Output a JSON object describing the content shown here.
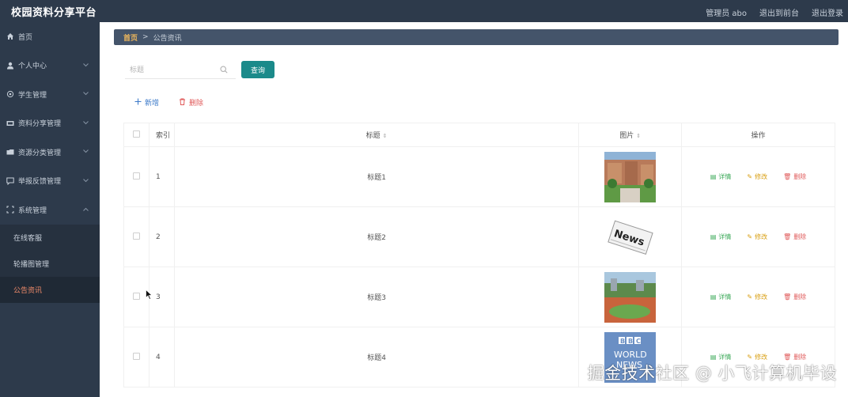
{
  "app": {
    "title": "校园资料分享平台"
  },
  "topbar": {
    "user": "管理员 abo",
    "to_front": "退出到前台",
    "logout": "退出登录"
  },
  "sidebar": {
    "items": [
      {
        "label": "首页",
        "icon": "home-icon"
      },
      {
        "label": "个人中心",
        "icon": "user-icon"
      },
      {
        "label": "学生管理",
        "icon": "gear-icon"
      },
      {
        "label": "资料分享管理",
        "icon": "share-icon"
      },
      {
        "label": "资源分类管理",
        "icon": "folder-icon"
      },
      {
        "label": "举报反馈管理",
        "icon": "chat-icon"
      },
      {
        "label": "系统管理",
        "icon": "system-icon"
      }
    ],
    "sub_items": [
      {
        "label": "在线客服"
      },
      {
        "label": "轮播图管理"
      },
      {
        "label": "公告资讯"
      }
    ]
  },
  "breadcrumb": {
    "home": "首页",
    "separator": ">",
    "current": "公告资讯"
  },
  "search": {
    "placeholder": "标题",
    "value": "",
    "button": "查询"
  },
  "actions": {
    "add": "新增",
    "delete": "删除"
  },
  "table": {
    "headers": {
      "index": "索引",
      "title": "标题",
      "image": "图片",
      "ops": "操作"
    },
    "rows": [
      {
        "index": "1",
        "title": "标题1",
        "image": "campus-building-photo"
      },
      {
        "index": "2",
        "title": "标题2",
        "image": "news-newspaper-image"
      },
      {
        "index": "3",
        "title": "标题3",
        "image": "sports-field-photo"
      },
      {
        "index": "4",
        "title": "标题4",
        "image": "bbc-world-news-image"
      }
    ],
    "op_labels": {
      "detail": "详情",
      "edit": "修改",
      "delete": "删除"
    }
  },
  "watermark": "掘金技术社区 @ 小飞计算机毕设",
  "colors": {
    "sidebar_bg": "#2d3a4b",
    "breadcrumb_bg": "#44546a",
    "query_button": "#1b8a8a",
    "active_menu": "#f08b6a",
    "detail": "#3aa857",
    "edit": "#d9a015",
    "delete": "#e05a5a",
    "add": "#3a78c8"
  }
}
